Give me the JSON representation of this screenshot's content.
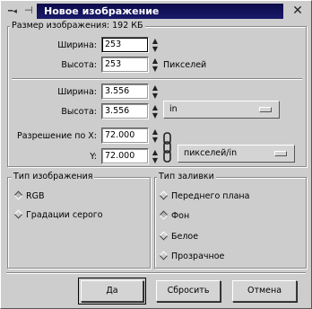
{
  "window": {
    "title": "Новое изображение",
    "menu_icon": "window-menu-icon",
    "pin_icon": "pin-icon",
    "close_glyph": "✕"
  },
  "size": {
    "heading": "Размер изображения: 192 КБ",
    "width_label": "Ширина:",
    "width_value": "253",
    "height_label": "Высота:",
    "height_value": "253",
    "pixels_unit": "Пикселей"
  },
  "print_size": {
    "width_label": "Ширина:",
    "width_value": "3.556",
    "height_label": "Высота:",
    "height_value": "3.556",
    "unit": "in",
    "res_x_label": "Разрешение по X:",
    "res_x_value": "72.000",
    "res_y_label": "Y:",
    "res_y_value": "72.000",
    "res_unit": "пикселей/in"
  },
  "image_type": {
    "heading": "Тип изображения",
    "options": [
      "RGB",
      "Градации серого"
    ],
    "selected": 0
  },
  "fill_type": {
    "heading": "Тип заливки",
    "options": [
      "Переднего плана",
      "Фон",
      "Белое",
      "Прозрачное"
    ],
    "selected": 1
  },
  "buttons": {
    "ok": "Да",
    "reset": "Сбросить",
    "cancel": "Отмена"
  }
}
